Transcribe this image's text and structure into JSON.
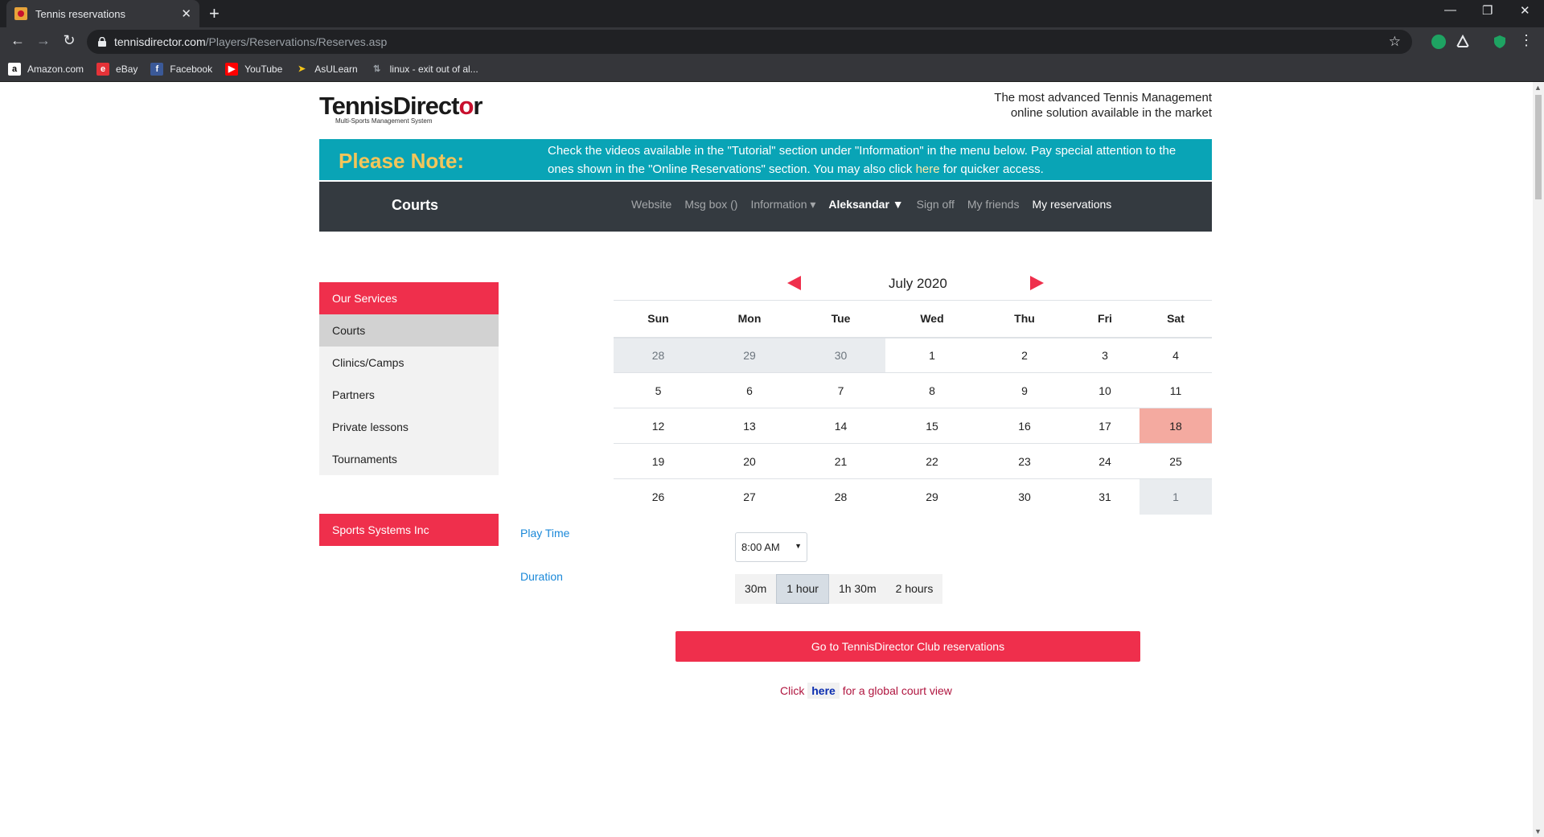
{
  "browser": {
    "tab_title": "Tennis reservations",
    "tab_close": "✕",
    "new_tab": "+",
    "minimize": "—",
    "restore": "❐",
    "close": "✕",
    "back": "←",
    "forward": "→",
    "reload": "↻",
    "url_host": "tennisdirector.com",
    "url_path": "/Players/Reservations/Reserves.asp",
    "star": "☆",
    "menu": "⋮",
    "bookmarks": [
      {
        "label": "Amazon.com",
        "icon": "a",
        "icon_bg": "#ffffff",
        "icon_fg": "#000000"
      },
      {
        "label": "eBay",
        "icon": "e",
        "icon_bg": "#e53238",
        "icon_fg": "#ffffff"
      },
      {
        "label": "Facebook",
        "icon": "f",
        "icon_bg": "#3b5998",
        "icon_fg": "#ffffff"
      },
      {
        "label": "YouTube",
        "icon": "▶",
        "icon_bg": "#ff0000",
        "icon_fg": "#ffffff"
      },
      {
        "label": "AsULearn",
        "icon": "➤",
        "icon_bg": "#35363a",
        "icon_fg": "#f5c518"
      },
      {
        "label": "linux - exit out of al...",
        "icon": "⇅",
        "icon_bg": "#35363a",
        "icon_fg": "#9aa0a6"
      }
    ]
  },
  "header": {
    "logo_part1": "TennisDirect",
    "logo_part2": "o",
    "logo_part3": "r",
    "logo_sub": "Multi-Sports Management System",
    "tagline_line1": "The most advanced Tennis Management",
    "tagline_line2": "online solution available in the market"
  },
  "note": {
    "title": "Please Note:",
    "text_before": "Check the videos available in the \"Tutorial\" section under \"Information\" in the menu below. Pay special attention to the ones shown in the \"Online Reservations\" section. You may also click ",
    "link": "here",
    "text_after": " for quicker access."
  },
  "navbar": {
    "brand": "Courts",
    "website": "Website",
    "msgbox": "Msg box ()",
    "information": "Information ▾",
    "user": "Aleksandar ▼",
    "signoff": "Sign off",
    "friends": "My friends",
    "reservations": "My reservations"
  },
  "sidebar": {
    "header": "Our Services",
    "items": [
      "Courts",
      "Clinics/Camps",
      "Partners",
      "Private lessons",
      "Tournaments"
    ],
    "footer": "Sports Systems Inc"
  },
  "calendar": {
    "month": "July 2020",
    "weekdays": [
      "Sun",
      "Mon",
      "Tue",
      "Wed",
      "Thu",
      "Fri",
      "Sat"
    ],
    "weeks": [
      [
        "28",
        "29",
        "30",
        "1",
        "2",
        "3",
        "4"
      ],
      [
        "5",
        "6",
        "7",
        "8",
        "9",
        "10",
        "11"
      ],
      [
        "12",
        "13",
        "14",
        "15",
        "16",
        "17",
        "18"
      ],
      [
        "19",
        "20",
        "21",
        "22",
        "23",
        "24",
        "25"
      ],
      [
        "26",
        "27",
        "28",
        "29",
        "30",
        "31",
        "1"
      ]
    ],
    "selected_day": "18"
  },
  "booking": {
    "play_time_label": "Play Time",
    "play_time_value": "8:00 AM",
    "duration_label": "Duration",
    "durations": [
      "30m",
      "1 hour",
      "1h 30m",
      "2 hours"
    ],
    "selected_duration": "1 hour",
    "cta": "Go to TennisDirector Club reservations",
    "footer_before": "Click",
    "footer_link": "here",
    "footer_after": "for a global court view"
  },
  "colors": {
    "accent": "#ef2f4c",
    "note_bg": "#09a4b6",
    "navbar_bg": "#343a40",
    "today_bg": "#f4aaa0"
  }
}
